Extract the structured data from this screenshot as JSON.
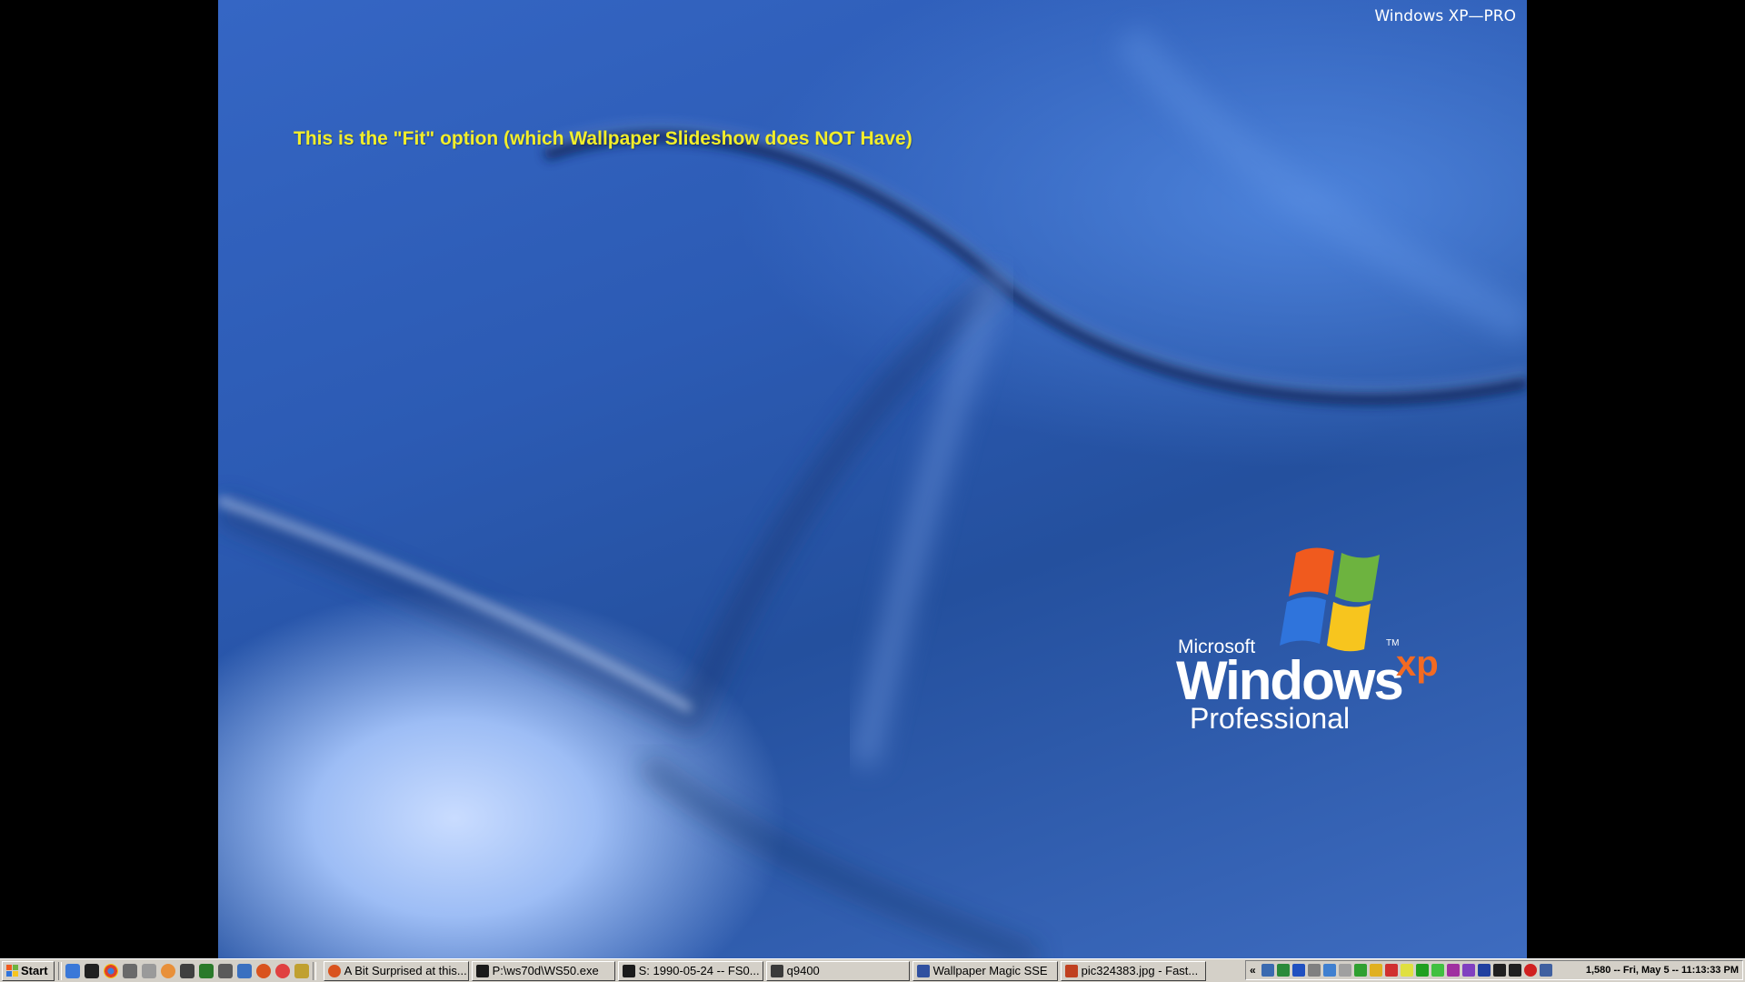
{
  "desktop": {
    "corner_label": "Windows XP—PRO",
    "caption": "This is the \"Fit\"  option (which Wallpaper Slideshow does NOT Have)",
    "logo": {
      "microsoft": "Microsoft",
      "trademark": "TM",
      "windows": "Windows",
      "xp": "xp",
      "edition": "Professional"
    }
  },
  "taskbar": {
    "start_label": "Start",
    "quick_launch": [
      "ie-icon",
      "cmd-icon",
      "chrome-icon",
      "app-icon",
      "tool-icon",
      "firefox-icon",
      "calc-icon",
      "media-icon",
      "app2-icon",
      "folder-icon",
      "firefox2-icon",
      "opera-icon",
      "paint-icon"
    ],
    "tasks": [
      {
        "label": "A Bit Surprised at this...",
        "icon": "firefox-icon",
        "color": "#d9531e"
      },
      {
        "label": "P:\\ws70d\\WS50.exe",
        "icon": "cmd-icon",
        "color": "#1a1a1a"
      },
      {
        "label": "S: 1990-05-24 -- FS0...",
        "icon": "cmd-icon",
        "color": "#1a1a1a"
      },
      {
        "label": "q9400",
        "icon": "monitor-icon",
        "color": "#3a3a3a"
      },
      {
        "label": "Wallpaper Magic SSE",
        "icon": "wand-icon",
        "color": "#3050a0"
      },
      {
        "label": "pic324383.jpg  -  Fast...",
        "icon": "image-viewer-icon",
        "color": "#c04020"
      }
    ],
    "tray_icons": [
      "#3a6ab0",
      "#2a8a3a",
      "#2050c0",
      "#808080",
      "#4080d0",
      "#a0a0a0",
      "#30a030",
      "#e0b020",
      "#d03030",
      "#e0e040",
      "#20a020",
      "#40c040",
      "#a030a0",
      "#8040c0",
      "#2040a0",
      "#202020",
      "#202020",
      "#d02020",
      "#4060a0"
    ],
    "clock": "1,580 -- Fri, May 5 -- 11:13:33 PM"
  }
}
